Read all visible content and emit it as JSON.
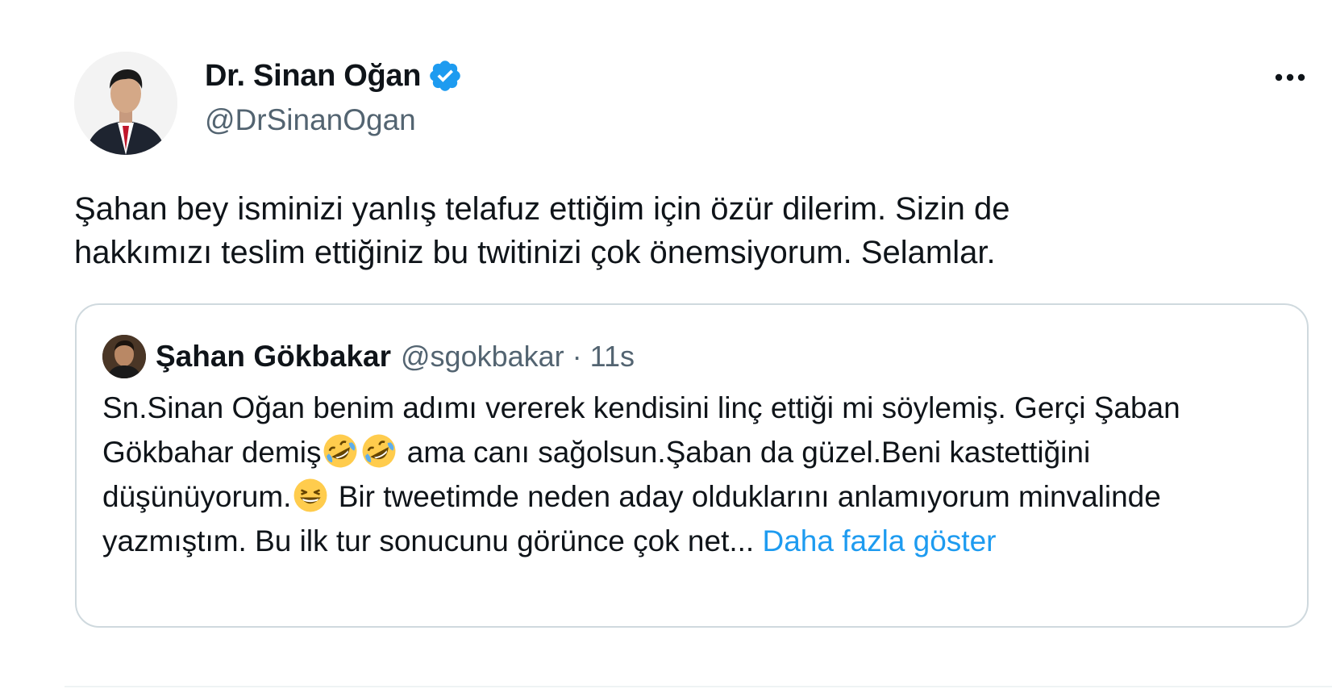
{
  "author": {
    "name": "Dr. Sinan Oğan",
    "handle": "@DrSinanOgan",
    "verified": true,
    "avatar_icon": "profile-photo-man-in-suit-icon",
    "badge_color": "#1d9bf0"
  },
  "more_icon": "more-dots-icon",
  "tweet": {
    "text": "Şahan bey isminizi yanlış telafuz ettiğim için özür dilerim. Sizin de\nhakkımızı teslim ettiğiniz bu twitinizi çok önemsiyorum. Selamlar."
  },
  "quote": {
    "name": "Şahan Gökbakar",
    "handle": "@sgokbakar",
    "separator": "·",
    "time": "11s",
    "text_part1": "Sn.Sinan Oğan benim adımı vererek kendisini linç ettiği mi söylemiş. Gerçi Şaban Gökbahar demiş",
    "emoji1": "rolling-on-floor-laughing",
    "emoji2": "rolling-on-floor-laughing",
    "text_part2": " ama canı sağolsun.Şaban da güzel.Beni kastettiğini düşünüyorum.",
    "emoji3": "grinning-squinting-face",
    "text_part3": " Bir tweetimde neden aday olduklarını anlamıyorum minvalinde yazmıştım. Bu ilk tur sonucunu görünce çok net...",
    "show_more": "Daha fazla göster"
  },
  "colors": {
    "text": "#0f1419",
    "secondary": "#536471",
    "link": "#1d9bf0",
    "border": "#cfd9de"
  }
}
